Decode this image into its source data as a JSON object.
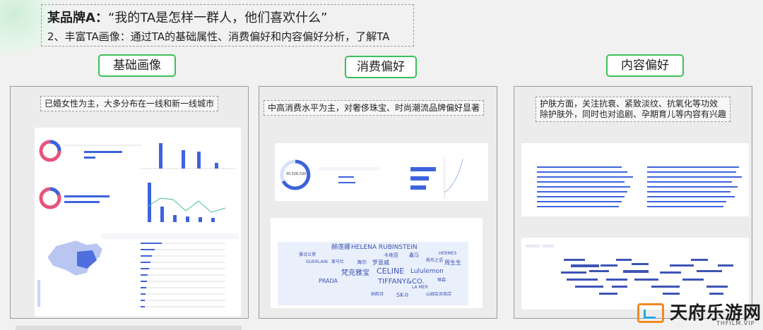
{
  "header": {
    "brand": "某品牌A：",
    "quote": "“我的TA是怎样一群人，他们喜欢什么”",
    "subtitle": "2、丰富TA画像：通过TA的基础属性、消费偏好和内容偏好分析，了解TA"
  },
  "tags": [
    "基础画像",
    "消费偏好",
    "内容偏好"
  ],
  "panels": {
    "basic": {
      "caption": "已婚女性为主，大多分布在一线和新一线城市"
    },
    "consume": {
      "caption": "中高消费水平为主，对奢侈珠宝、时尚潮流品牌偏好显著",
      "donut_value": "35,526,320",
      "wordcloud_words": [
        "赫莲娜",
        "HELENA RUBINSTEIN",
        "HERMES",
        "雅诗兰黛",
        "卡地亚",
        "鑫马",
        "帆布之语",
        "GUERLAIN",
        "爱马仕",
        "海尔",
        "罗意威",
        "周生生",
        "CELINE",
        "Lululemon",
        "梵克雅宝",
        "PRADA",
        "TIFFANY&CO.",
        "蒂森",
        "LA MER",
        "纳韵诗",
        "SK-II",
        "山姆会员商店"
      ]
    },
    "content": {
      "caption_line1": "护肤方面，关注抗衰、紧致淡纹、抗氧化等功效",
      "caption_line2": "除护肤外，同时也对追剧、孕期育儿等内容有兴趣"
    }
  },
  "logo": {
    "name": "天府乐游网",
    "url": "THFILM.VIP"
  },
  "colors": {
    "accent_green": "#3cbf5a",
    "chart_blue": "#3d63dd",
    "donut_pink": "#e8557a"
  }
}
